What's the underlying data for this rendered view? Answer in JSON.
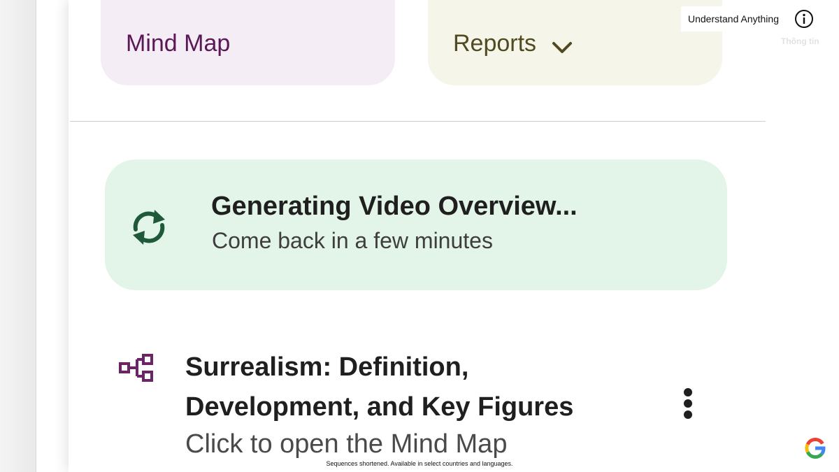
{
  "cards": {
    "mind_map_label": "Mind Map",
    "reports_label": "Reports"
  },
  "generating": {
    "title": "Generating Video Overview...",
    "subtitle": "Come back in a few minutes"
  },
  "mind_map_item": {
    "title": "Surrealism: Definition, Development, and Key Figures",
    "subtitle": "Click to open the Mind Map"
  },
  "overlay": {
    "brand_label": "Understand Anything",
    "watermark": "Thông tin",
    "disclaimer": "Sequences shortened. Available in select countries and languages."
  },
  "icons": {
    "sync": "sync-icon",
    "mind_map": "mind-map-icon",
    "chevron": "chevron-down-icon",
    "more": "more-vert-icon",
    "info": "info-icon",
    "google": "google-logo"
  },
  "colors": {
    "mind_map_card_bg": "#f5edf5",
    "mind_map_text": "#5b1856",
    "reports_card_bg": "#f6f5ea",
    "reports_text": "#4f4a20",
    "generating_card_bg": "#e3f4e8",
    "sync_icon": "#1e5a3a",
    "mind_map_icon": "#6b2466"
  }
}
